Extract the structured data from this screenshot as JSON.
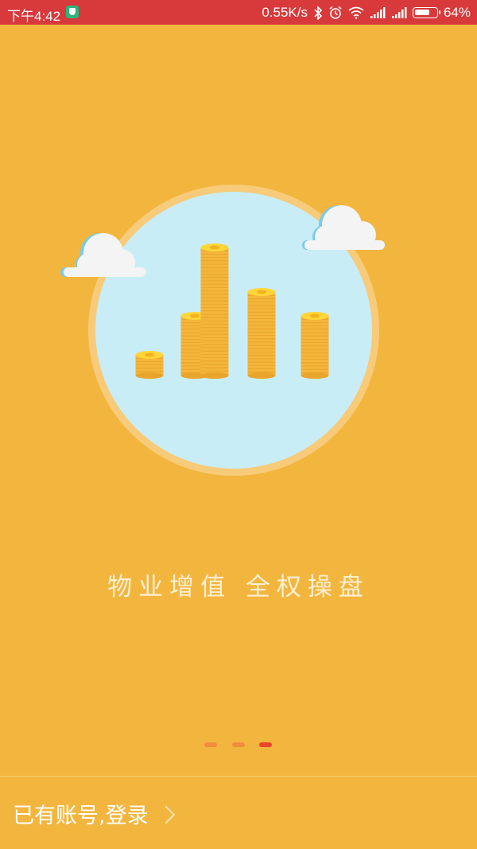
{
  "status_bar": {
    "time": "下午4:42",
    "network_speed": "0.55K/s",
    "battery_percent": "64%",
    "icons": [
      "shield-icon",
      "bluetooth-icon",
      "alarm-icon",
      "wifi-icon",
      "signal-icon",
      "signal-icon",
      "battery-icon"
    ]
  },
  "onboarding": {
    "tagline": "物业增值  全权操盘",
    "page_indicator": {
      "count": 3,
      "active_index": 2
    }
  },
  "footer": {
    "login_label": "已有账号,登录"
  },
  "colors": {
    "background": "#F2B63F",
    "status_bar": "#D8393A",
    "circle": "#C9EDF6",
    "coin": "#F4B63A",
    "dot_active": "#E8452C",
    "dot_inactive": "#F28C3C"
  }
}
